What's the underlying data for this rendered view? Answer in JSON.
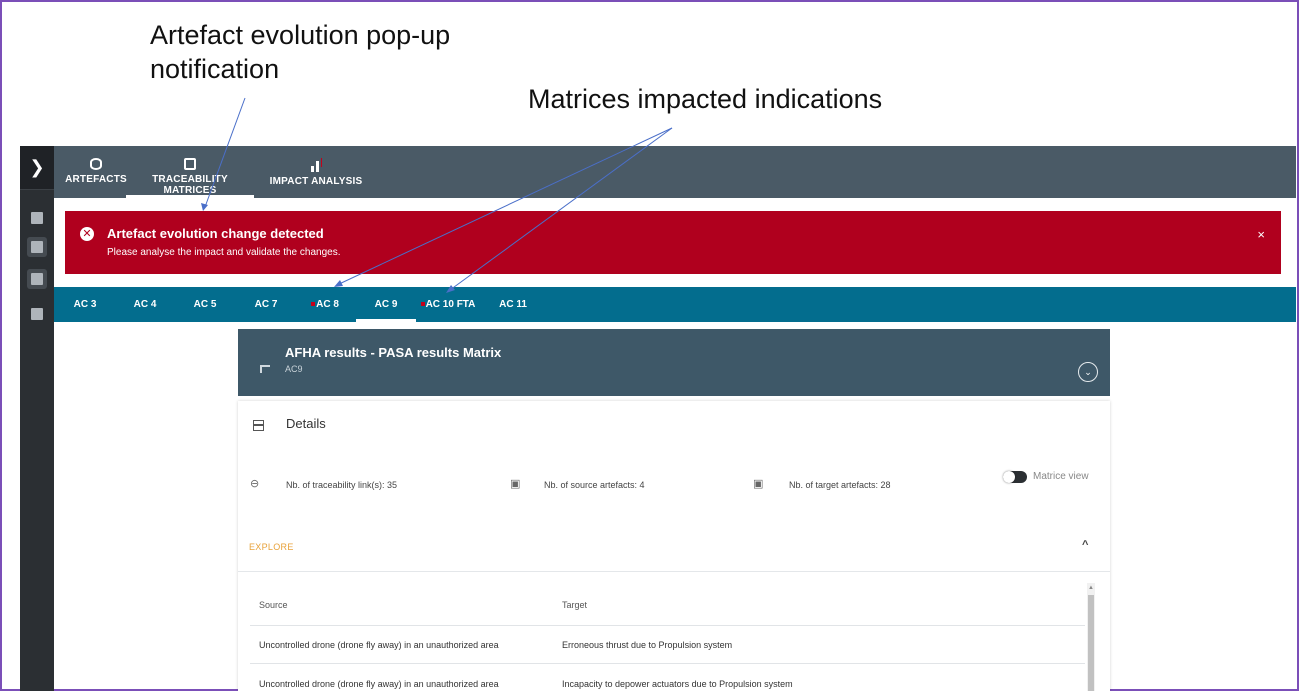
{
  "annotations": {
    "popup_callout": "Artefact evolution pop-up notification",
    "matrices_callout": "Matrices impacted indications"
  },
  "top_tabs": [
    {
      "label": "ARTEFACTS",
      "icon": "database-icon"
    },
    {
      "label": "TRACEABILITY MATRICES",
      "icon": "matrix-icon",
      "active": true
    },
    {
      "label": "IMPACT ANALYSIS",
      "icon": "chart-icon"
    }
  ],
  "sidebar": {
    "items": [
      "dashboard-icon",
      "database-settings-icon",
      "monitor-icon",
      "report-settings-icon"
    ]
  },
  "alert": {
    "title": "Artefact evolution change detected",
    "message": "Please analyse the impact and validate the changes.",
    "close": "×",
    "color": "#b0001e"
  },
  "ac_tabs": [
    {
      "label": "AC 3",
      "impacted": false
    },
    {
      "label": "AC 4",
      "impacted": false
    },
    {
      "label": "AC 5",
      "impacted": false
    },
    {
      "label": "AC 7",
      "impacted": false
    },
    {
      "label": "AC 8",
      "impacted": true
    },
    {
      "label": "AC 9",
      "impacted": false,
      "active": true
    },
    {
      "label": "AC 10 FTA",
      "impacted": true
    },
    {
      "label": "AC 11",
      "impacted": false
    }
  ],
  "matrix": {
    "title": "AFHA results - PASA results Matrix",
    "subtitle": "AC9",
    "details_title": "Details",
    "links": "Nb. of traceability link(s): 35",
    "sources": "Nb. of source artefacts: 4",
    "targets": "Nb. of target artefacts: 28",
    "toggle_label": "Matrice view",
    "explore_label": "EXPLORE",
    "columns": [
      "Source",
      "Target"
    ],
    "rows": [
      {
        "source": "Uncontrolled drone (drone fly away) in an unauthorized area",
        "target": "Erroneous thrust due to Propulsion system"
      },
      {
        "source": "Uncontrolled drone (drone fly away) in an unauthorized area",
        "target": "Incapacity to depower actuators due to Propulsion system"
      }
    ]
  },
  "colors": {
    "topbar": "#4a5a66",
    "ac_bar": "#036d8e",
    "card_header": "#3e5868",
    "explore": "#e8a23a",
    "frame": "#7b4fb8"
  }
}
